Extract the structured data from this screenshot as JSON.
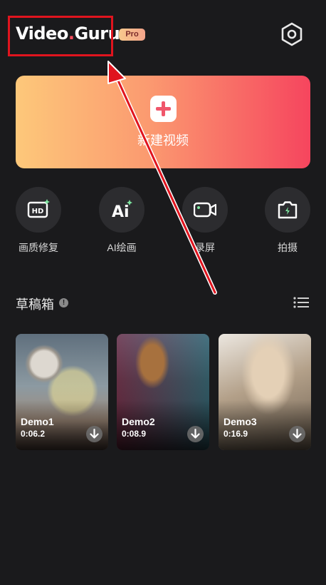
{
  "header": {
    "logo_main": "Video",
    "logo_dot": ".",
    "logo_tail": "Guru",
    "pro_badge": "Pro"
  },
  "new_video": {
    "label": "新建视频"
  },
  "tools": [
    {
      "label": "画质修复",
      "icon": "hd-icon"
    },
    {
      "label": "AI绘画",
      "icon": "ai-sparkle-icon"
    },
    {
      "label": "录屏",
      "icon": "screen-record-icon"
    },
    {
      "label": "拍摄",
      "icon": "camera-icon"
    }
  ],
  "drafts": {
    "title": "草稿箱",
    "items": [
      {
        "name": "Demo1",
        "duration": "0:06.2"
      },
      {
        "name": "Demo2",
        "duration": "0:08.9"
      },
      {
        "name": "Demo3",
        "duration": "0:16.9"
      }
    ]
  },
  "colors": {
    "background": "#1a1a1c",
    "card_gradient_start": "#fdc87a",
    "card_gradient_end": "#f6455e",
    "annotation_red": "#e0141e"
  }
}
